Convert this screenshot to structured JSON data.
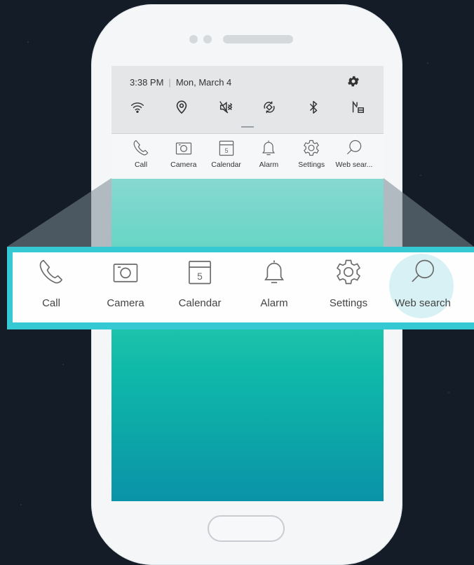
{
  "status": {
    "time": "3:38 PM",
    "date": "Mon, March 4"
  },
  "quick_settings_icons": [
    "wifi-icon",
    "location-icon",
    "mute-icon",
    "auto-rotate-icon",
    "bluetooth-icon",
    "mobile-data-icon"
  ],
  "shortcuts": [
    {
      "label": "Call",
      "icon": "phone-icon"
    },
    {
      "label": "Camera",
      "icon": "camera-icon"
    },
    {
      "label": "Calendar",
      "icon": "calendar-icon",
      "day": "5"
    },
    {
      "label": "Alarm",
      "icon": "bell-icon"
    },
    {
      "label": "Settings",
      "icon": "gear-icon"
    },
    {
      "label": "Web sear...",
      "icon": "search-icon"
    }
  ],
  "zoomed_shortcuts": [
    {
      "label": "Call"
    },
    {
      "label": "Camera"
    },
    {
      "label": "Calendar",
      "day": "5"
    },
    {
      "label": "Alarm"
    },
    {
      "label": "Settings"
    },
    {
      "label": "Web search"
    }
  ],
  "colors": {
    "accent": "#35c9d4",
    "background": "#141d27"
  }
}
